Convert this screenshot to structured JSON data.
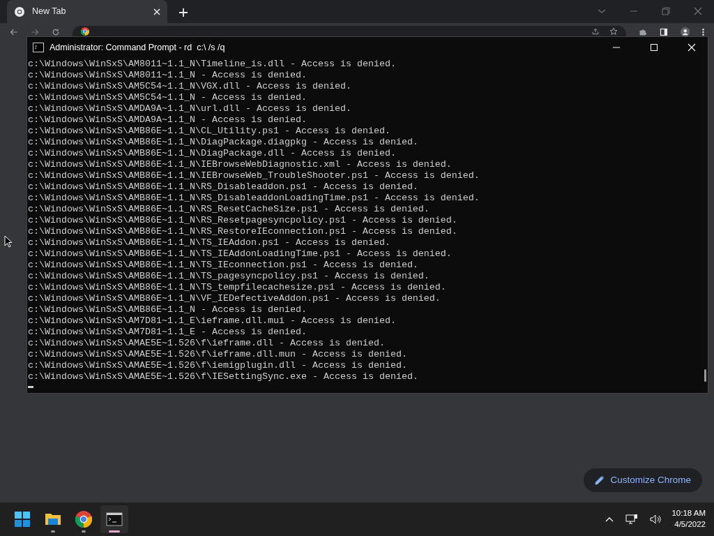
{
  "browser": {
    "tabs": [
      {
        "label": "New Tab",
        "selected": true
      }
    ],
    "customize_button": "Customize Chrome"
  },
  "console": {
    "title": "Administrator: Command Prompt - rd  c:\\ /s /q",
    "lines": [
      "c:\\Windows\\WinSxS\\AM8011~1.1_N\\Timeline_is.dll - Access is denied.",
      "c:\\Windows\\WinSxS\\AM8011~1.1_N - Access is denied.",
      "c:\\Windows\\WinSxS\\AM5C54~1.1_N\\VGX.dll - Access is denied.",
      "c:\\Windows\\WinSxS\\AM5C54~1.1_N - Access is denied.",
      "c:\\Windows\\WinSxS\\AMDA9A~1.1_N\\url.dll - Access is denied.",
      "c:\\Windows\\WinSxS\\AMDA9A~1.1_N - Access is denied.",
      "c:\\Windows\\WinSxS\\AMB86E~1.1_N\\CL_Utility.ps1 - Access is denied.",
      "c:\\Windows\\WinSxS\\AMB86E~1.1_N\\DiagPackage.diagpkg - Access is denied.",
      "c:\\Windows\\WinSxS\\AMB86E~1.1_N\\DiagPackage.dll - Access is denied.",
      "c:\\Windows\\WinSxS\\AMB86E~1.1_N\\IEBrowseWebDiagnostic.xml - Access is denied.",
      "c:\\Windows\\WinSxS\\AMB86E~1.1_N\\IEBrowseWeb_TroubleShooter.ps1 - Access is denied.",
      "c:\\Windows\\WinSxS\\AMB86E~1.1_N\\RS_Disableaddon.ps1 - Access is denied.",
      "c:\\Windows\\WinSxS\\AMB86E~1.1_N\\RS_DisableaddonLoadingTime.ps1 - Access is denied.",
      "c:\\Windows\\WinSxS\\AMB86E~1.1_N\\RS_ResetCacheSize.ps1 - Access is denied.",
      "c:\\Windows\\WinSxS\\AMB86E~1.1_N\\RS_Resetpagesyncpolicy.ps1 - Access is denied.",
      "c:\\Windows\\WinSxS\\AMB86E~1.1_N\\RS_RestoreIEconnection.ps1 - Access is denied.",
      "c:\\Windows\\WinSxS\\AMB86E~1.1_N\\TS_IEAddon.ps1 - Access is denied.",
      "c:\\Windows\\WinSxS\\AMB86E~1.1_N\\TS_IEAddonLoadingTime.ps1 - Access is denied.",
      "c:\\Windows\\WinSxS\\AMB86E~1.1_N\\TS_IEconnection.ps1 - Access is denied.",
      "c:\\Windows\\WinSxS\\AMB86E~1.1_N\\TS_pagesyncpolicy.ps1 - Access is denied.",
      "c:\\Windows\\WinSxS\\AMB86E~1.1_N\\TS_tempfilecachesize.ps1 - Access is denied.",
      "c:\\Windows\\WinSxS\\AMB86E~1.1_N\\VF_IEDefectiveAddon.ps1 - Access is denied.",
      "c:\\Windows\\WinSxS\\AMB86E~1.1_N - Access is denied.",
      "c:\\Windows\\WinSxS\\AM7D81~1.1_E\\ieframe.dll.mui - Access is denied.",
      "c:\\Windows\\WinSxS\\AM7D81~1.1_E - Access is denied.",
      "c:\\Windows\\WinSxS\\AMAE5E~1.526\\f\\ieframe.dll - Access is denied.",
      "c:\\Windows\\WinSxS\\AMAE5E~1.526\\f\\ieframe.dll.mun - Access is denied.",
      "c:\\Windows\\WinSxS\\AMAE5E~1.526\\f\\iemigplugin.dll - Access is denied.",
      "c:\\Windows\\WinSxS\\AMAE5E~1.526\\f\\IESettingSync.exe - Access is denied."
    ]
  },
  "taskbar": {
    "apps": [
      {
        "kind": "start",
        "running": false,
        "active": false
      },
      {
        "kind": "explorer",
        "running": true,
        "active": false
      },
      {
        "kind": "chrome",
        "running": true,
        "active": false
      },
      {
        "kind": "terminal",
        "running": true,
        "active": true
      }
    ],
    "clock": {
      "time": "10:18 AM",
      "date": "4/5/2022"
    }
  }
}
